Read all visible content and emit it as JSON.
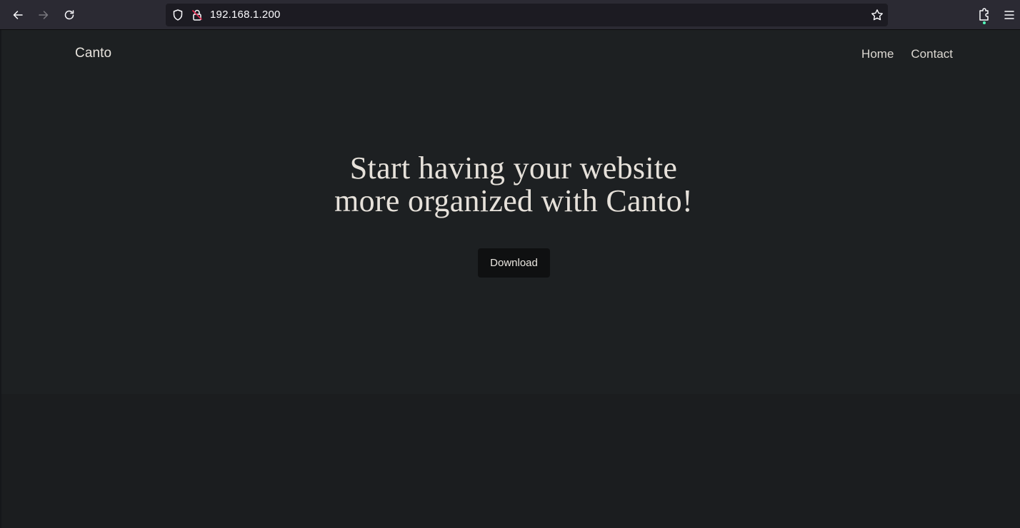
{
  "browser": {
    "url": "192.168.1.200",
    "icons": {
      "back": "arrow-left-icon",
      "forward": "arrow-right-icon",
      "reload": "reload-icon",
      "tracking": "shield-icon",
      "security": "lock-warning-icon",
      "bookmark": "star-icon",
      "extensions": "puzzle-icon",
      "menu": "hamburger-menu-icon"
    }
  },
  "site": {
    "brand": "Canto",
    "nav": [
      "Home",
      "Contact"
    ],
    "hero": {
      "line1": "Start having your website",
      "line2": "more organized with Canto!",
      "cta": "Download"
    }
  },
  "colors": {
    "toolbar": "#2b2a33",
    "urlbar": "#1c1b22",
    "hero_bg": "#1d2022",
    "page_bg": "#1b1d1f",
    "button_bg": "#0f1011",
    "text": "#e6e1da"
  }
}
